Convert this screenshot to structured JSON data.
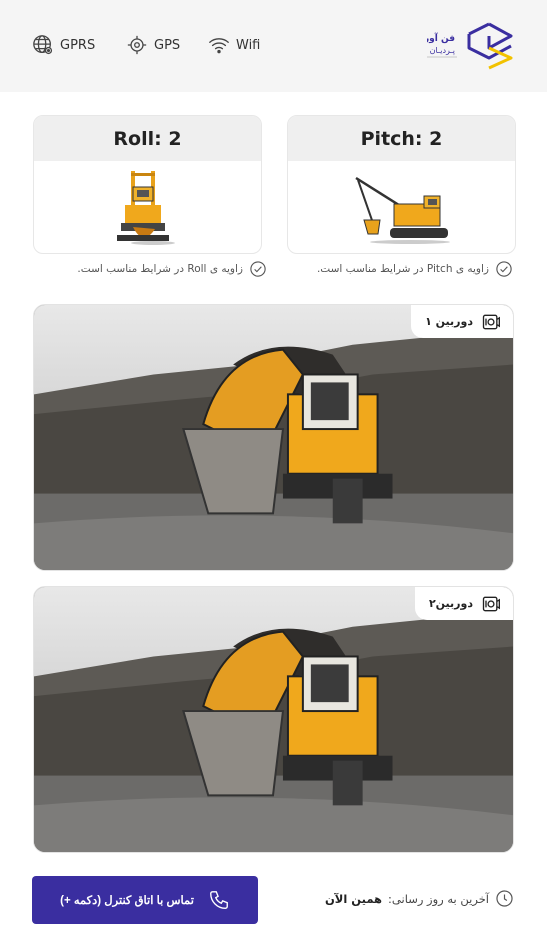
{
  "header": {
    "status": [
      {
        "label": "GPRS",
        "icon": "globe-icon"
      },
      {
        "label": "GPS",
        "icon": "gps-icon"
      },
      {
        "label": "Wifi",
        "icon": "wifi-icon"
      }
    ],
    "logo": {
      "line1": "فن آوران",
      "line2": "پـرديـان",
      "accent": "#f2c200",
      "brand": "#3a2ea0"
    }
  },
  "angles": {
    "roll": {
      "label": "Roll: 2",
      "status": "زاویه ی Roll در شرایط مناسب است."
    },
    "pitch": {
      "label": "Pitch: 2",
      "status": "زاویه ی Pitch در شرایط مناسب است."
    }
  },
  "cameras": [
    {
      "label": "دوربین ۱"
    },
    {
      "label": "دوربین۲"
    }
  ],
  "footer": {
    "call_button": "تماس با اتاق کنترل (دکمه +)",
    "updated_label": "آخرین به روز رسانی:",
    "updated_value": "همین الآن"
  },
  "colors": {
    "primary": "#3a2ea0",
    "machine_yellow": "#f0a81c",
    "header_bg": "#f5f5f5"
  }
}
